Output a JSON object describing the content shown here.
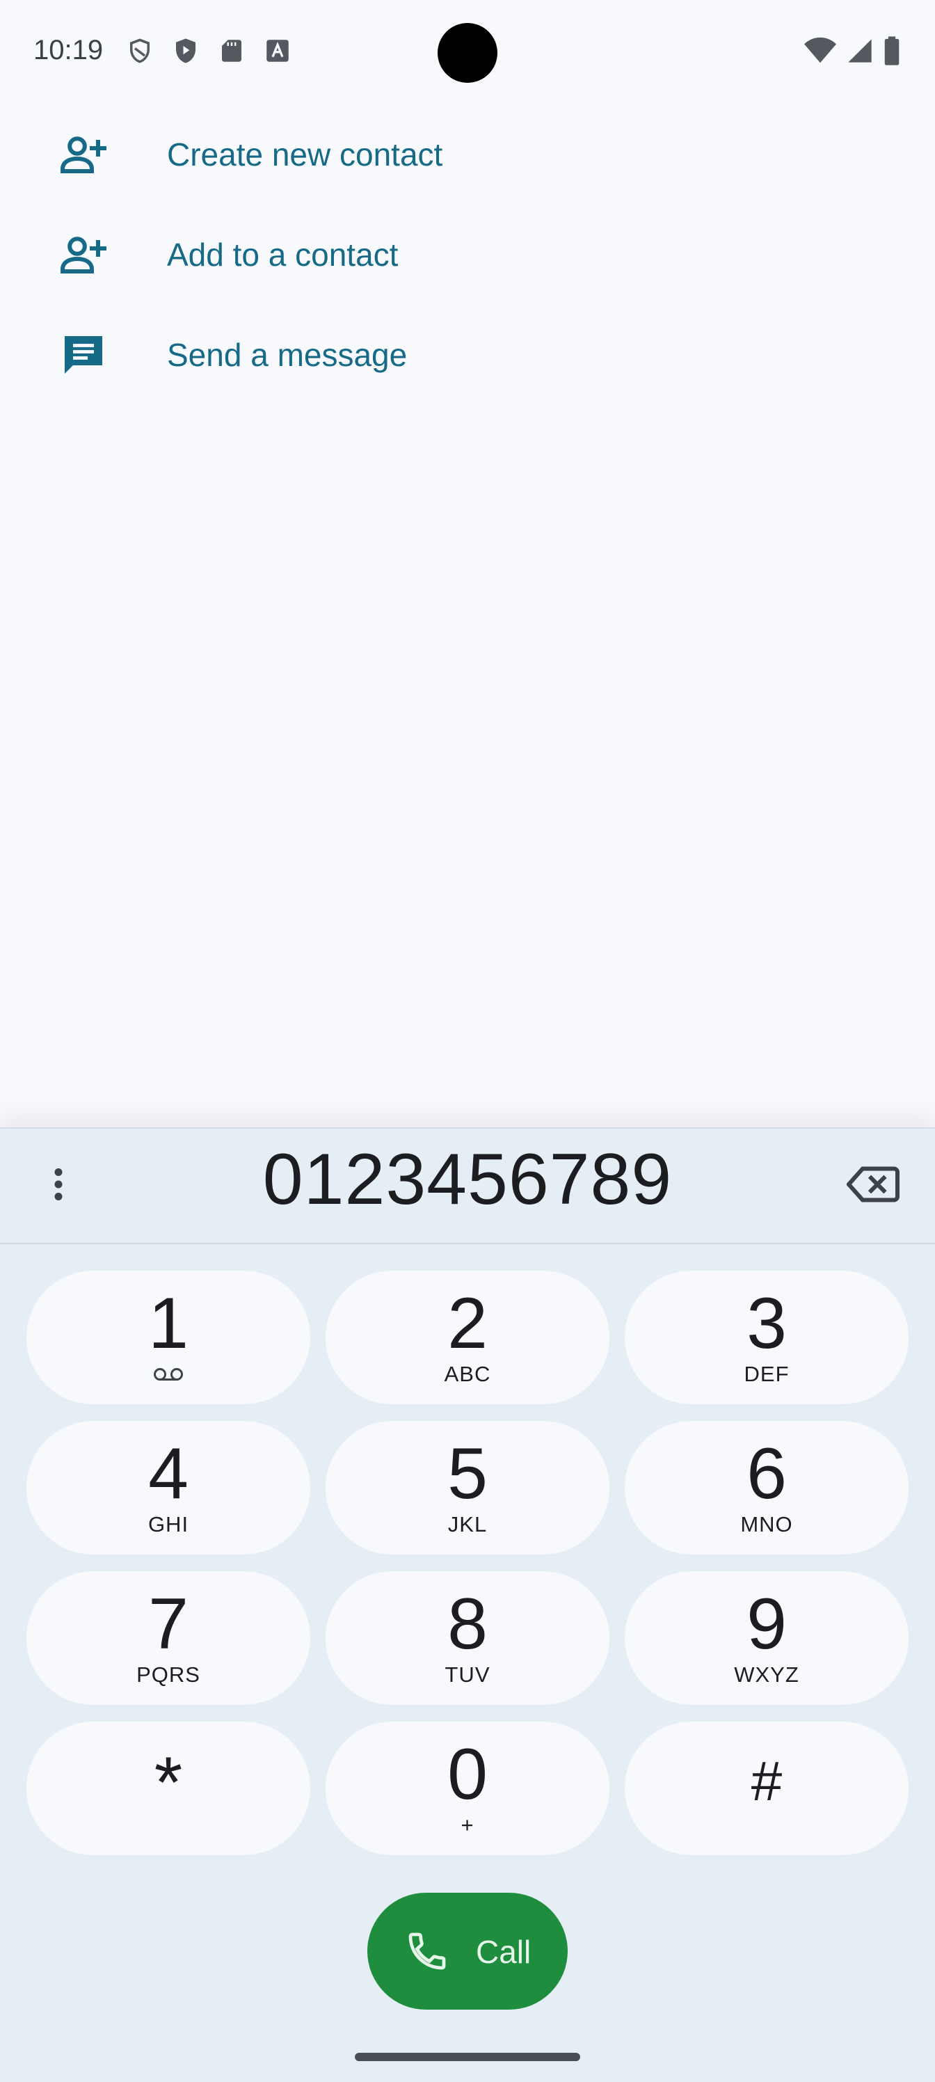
{
  "status_bar": {
    "time": "10:19",
    "left_icons": [
      "shield-outline-icon",
      "shield-play-icon",
      "sd-card-icon",
      "font-a-icon"
    ],
    "right_icons": [
      "wifi-icon",
      "cell-signal-icon",
      "battery-icon"
    ]
  },
  "actions": [
    {
      "label": "Create new contact",
      "icon": "person-add-icon"
    },
    {
      "label": "Add to a contact",
      "icon": "person-add-icon"
    },
    {
      "label": "Send a message",
      "icon": "message-icon"
    }
  ],
  "dialer": {
    "digits": "0123456789",
    "keys": [
      {
        "digit": "1",
        "letters": "",
        "voicemail": true
      },
      {
        "digit": "2",
        "letters": "ABC"
      },
      {
        "digit": "3",
        "letters": "DEF"
      },
      {
        "digit": "4",
        "letters": "GHI"
      },
      {
        "digit": "5",
        "letters": "JKL"
      },
      {
        "digit": "6",
        "letters": "MNO"
      },
      {
        "digit": "7",
        "letters": "PQRS"
      },
      {
        "digit": "8",
        "letters": "TUV"
      },
      {
        "digit": "9",
        "letters": "WXYZ"
      },
      {
        "digit": "*",
        "letters": ""
      },
      {
        "digit": "0",
        "letters": "+"
      },
      {
        "digit": "#",
        "letters": ""
      }
    ],
    "call_label": "Call"
  },
  "colors": {
    "accent_text": "#166a87",
    "call_green": "#1e8e3e",
    "sheet_bg": "#e6eef5",
    "key_bg": "#f8f9fc"
  }
}
